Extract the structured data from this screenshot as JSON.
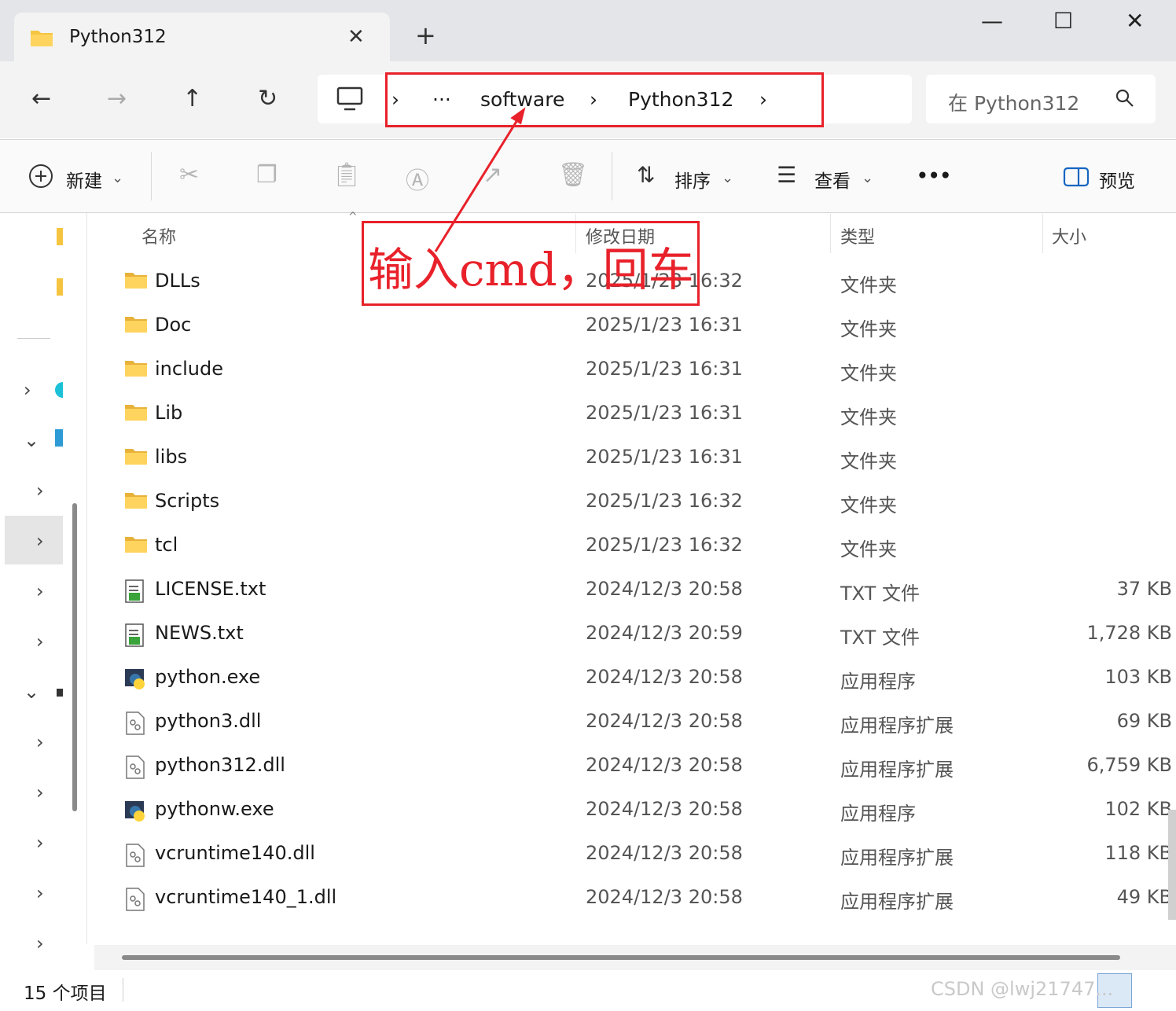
{
  "window": {
    "tab_title": "Python312",
    "new_tab": "+"
  },
  "nav": {
    "breadcrumbs": [
      "software",
      "Python312"
    ],
    "ellipsis": "···",
    "search_placeholder": "在 Python312"
  },
  "toolbar": {
    "new_label": "新建",
    "sort_label": "排序",
    "view_label": "查看",
    "more_label": "•••",
    "preview_label": "预览"
  },
  "columns": {
    "name": "名称",
    "date": "修改日期",
    "type": "类型",
    "size": "大小"
  },
  "files": [
    {
      "name": "DLLs",
      "date": "2025/1/23 16:32",
      "type": "文件夹",
      "size": "",
      "icon": "folder-icon"
    },
    {
      "name": "Doc",
      "date": "2025/1/23 16:31",
      "type": "文件夹",
      "size": "",
      "icon": "folder-icon"
    },
    {
      "name": "include",
      "date": "2025/1/23 16:31",
      "type": "文件夹",
      "size": "",
      "icon": "folder-icon"
    },
    {
      "name": "Lib",
      "date": "2025/1/23 16:31",
      "type": "文件夹",
      "size": "",
      "icon": "folder-icon"
    },
    {
      "name": "libs",
      "date": "2025/1/23 16:31",
      "type": "文件夹",
      "size": "",
      "icon": "folder-icon"
    },
    {
      "name": "Scripts",
      "date": "2025/1/23 16:32",
      "type": "文件夹",
      "size": "",
      "icon": "folder-icon"
    },
    {
      "name": "tcl",
      "date": "2025/1/23 16:32",
      "type": "文件夹",
      "size": "",
      "icon": "folder-icon"
    },
    {
      "name": "LICENSE.txt",
      "date": "2024/12/3 20:58",
      "type": "TXT 文件",
      "size": "37 KB",
      "icon": "text-file-icon"
    },
    {
      "name": "NEWS.txt",
      "date": "2024/12/3 20:59",
      "type": "TXT 文件",
      "size": "1,728 KB",
      "icon": "text-file-icon"
    },
    {
      "name": "python.exe",
      "date": "2024/12/3 20:58",
      "type": "应用程序",
      "size": "103 KB",
      "icon": "python-exe-icon"
    },
    {
      "name": "python3.dll",
      "date": "2024/12/3 20:58",
      "type": "应用程序扩展",
      "size": "69 KB",
      "icon": "dll-file-icon"
    },
    {
      "name": "python312.dll",
      "date": "2024/12/3 20:58",
      "type": "应用程序扩展",
      "size": "6,759 KB",
      "icon": "dll-file-icon"
    },
    {
      "name": "pythonw.exe",
      "date": "2024/12/3 20:58",
      "type": "应用程序",
      "size": "102 KB",
      "icon": "python-exe-icon"
    },
    {
      "name": "vcruntime140.dll",
      "date": "2024/12/3 20:58",
      "type": "应用程序扩展",
      "size": "118 KB",
      "icon": "dll-file-icon"
    },
    {
      "name": "vcruntime140_1.dll",
      "date": "2024/12/3 20:58",
      "type": "应用程序扩展",
      "size": "49 KB",
      "icon": "dll-file-icon"
    }
  ],
  "status": {
    "item_count": "15 个项目"
  },
  "annotation": {
    "text": "输入cmd，回车"
  },
  "watermark": "CSDN @lwj21747... ",
  "colors": {
    "annotation_red": "#e8212a",
    "folder_yellow": "#f5c542",
    "titlebar_bg": "#e3e5e8",
    "nav_bg": "#f3f3f3"
  }
}
